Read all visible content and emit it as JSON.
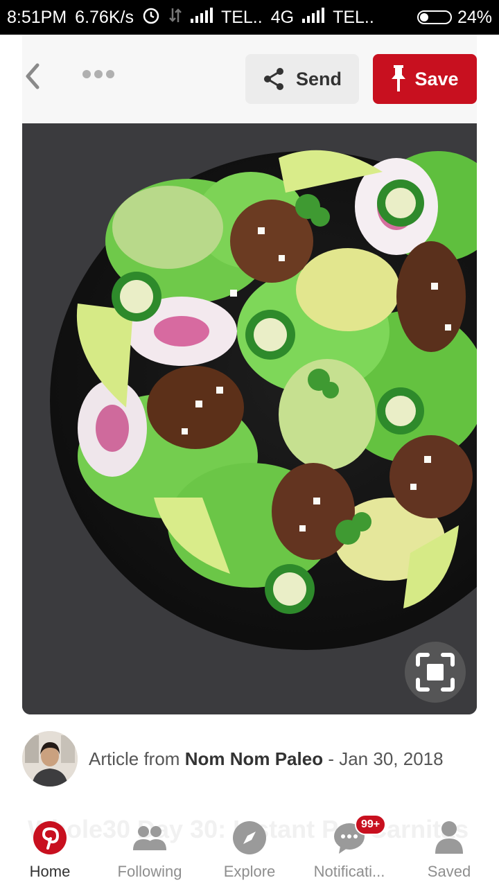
{
  "status_bar": {
    "time": "8:51PM",
    "speed": "6.76K/s",
    "carrier1": "TEL..",
    "network": "4G",
    "carrier2": "TEL..",
    "battery": "24%"
  },
  "toolbar": {
    "send_label": "Send",
    "save_label": "Save"
  },
  "attribution": {
    "prefix": "Article from",
    "source": "Nom Nom Paleo",
    "separator": "-",
    "date": "Jan 30, 2018"
  },
  "pin": {
    "title_partial": "Whole30 Day 30: Instant Pot Carnitas"
  },
  "nav": {
    "items": [
      {
        "label": "Home",
        "icon": "pinterest-logo-icon"
      },
      {
        "label": "Following",
        "icon": "people-icon"
      },
      {
        "label": "Explore",
        "icon": "compass-icon"
      },
      {
        "label": "Notificati...",
        "icon": "chat-bubble-icon",
        "badge": "99+"
      },
      {
        "label": "Saved",
        "icon": "person-icon"
      }
    ]
  },
  "colors": {
    "accent": "#c8101f"
  }
}
